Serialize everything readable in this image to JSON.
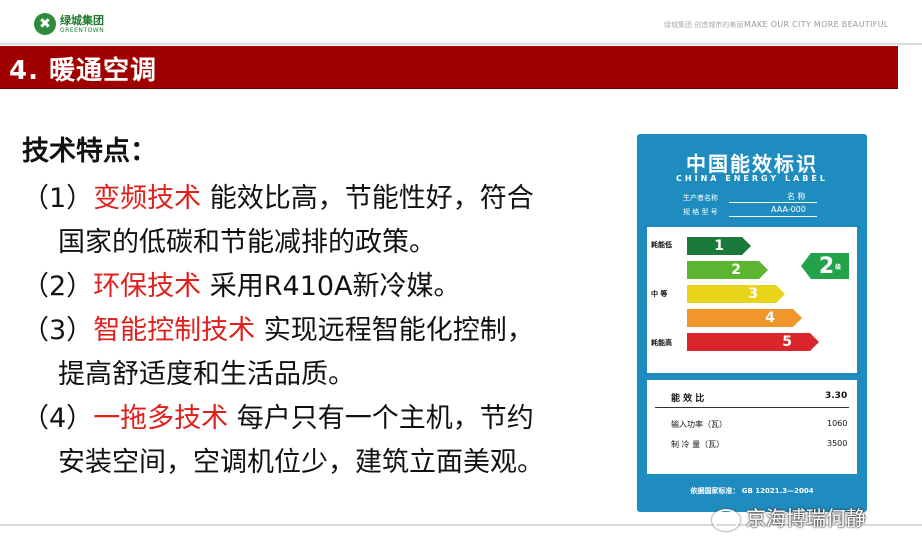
{
  "header": {
    "logo_mark": "✖",
    "logo_cn": "绿城集团",
    "logo_en": "GREENTOWN",
    "tagline_cn": "绿城集团  创造城市的美丽",
    "tagline_en": "MAKE OUR CITY MORE BEAUTIFUL"
  },
  "title": "4.  暖通空调",
  "content": {
    "heading": "技术特点：",
    "items": [
      {
        "num": "（1）",
        "highlight": "变频技术",
        "text": "  能效比高，节能性好，符合",
        "cont": "国家的低碳和节能减排的政策。"
      },
      {
        "num": "（2）",
        "highlight": "环保技术",
        "text": "  采用R410A新冷媒。",
        "cont": ""
      },
      {
        "num": "（3）",
        "highlight": "智能控制技术",
        "text": "  实现远程智能化控制，",
        "cont": "提高舒适度和生活品质。"
      },
      {
        "num": "（4）",
        "highlight": "一拖多技术",
        "text": "  每户只有一个主机，节约",
        "cont": "安装空间，空调机位少，建筑立面美观。"
      }
    ]
  },
  "energy_label": {
    "title": "中国能效标识",
    "subtitle": "CHINA  ENERGY  LABEL",
    "maker_label": "生产者名称",
    "maker_value": "名 称",
    "model_label": "规 格 型 号",
    "model_value": "AAA-000",
    "scale_low": "耗能低",
    "scale_mid": "中  等",
    "scale_high": "耗能高",
    "grades": [
      "1",
      "2",
      "3",
      "4",
      "5"
    ],
    "grade_colors": [
      "#1a7a3c",
      "#5cb530",
      "#e8d51b",
      "#f0962a",
      "#d9262a"
    ],
    "current_grade": "2",
    "current_grade_suffix": "级",
    "eer_label": "能 效 比",
    "eer_value": "3.30",
    "input_power_label": "输入功率（瓦）",
    "input_power_value": "1060",
    "cooling_label": "制 冷 量（瓦）",
    "cooling_value": "3500",
    "standard": "依据国家标准：  GB 12021.3—2004"
  },
  "watermark": "京海博瑞何静"
}
